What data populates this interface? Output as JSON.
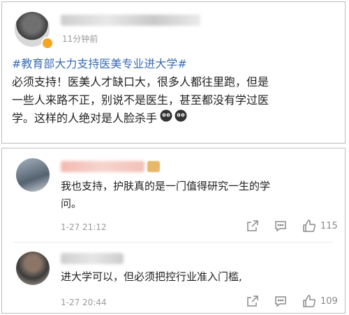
{
  "post": {
    "time": "11分钟前",
    "hashtag": "#教育部大力支持医美专业进大学#",
    "lines": [
      "必须支持！医美人才缺口大，很多人都往里跑，但是",
      "一些人来路不正，别说不是医生，甚至都没有学过医",
      "学。这样的人绝对是人脸杀手"
    ]
  },
  "comments": [
    {
      "lines": [
        "我也支持，护肤真的是一门值得研究一生的学",
        "问。"
      ],
      "time": "1-27 21:12",
      "likes": "115"
    },
    {
      "lines": [
        "进大学可以，但必须把控行业准入门槛,"
      ],
      "time": "1-27 20:44",
      "likes": "109"
    }
  ]
}
